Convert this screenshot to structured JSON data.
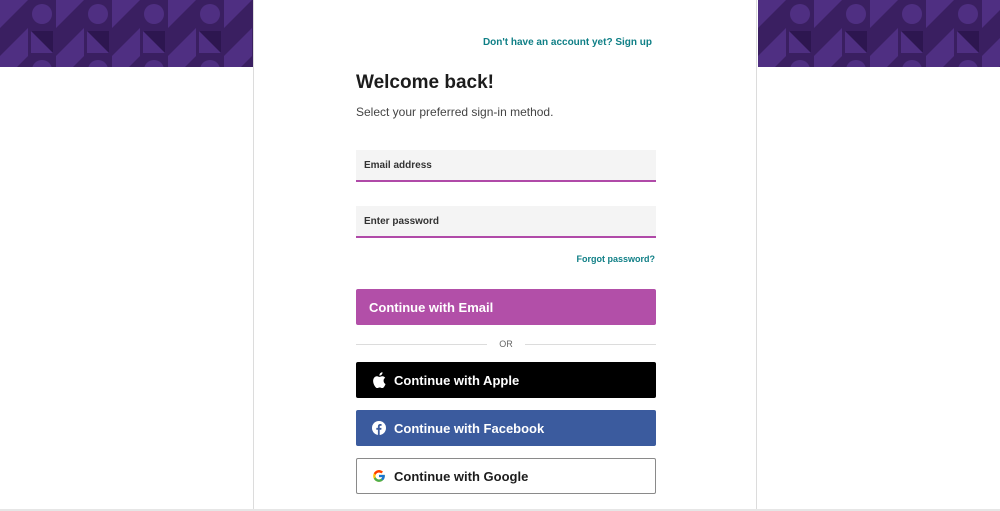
{
  "header": {
    "signup_link": "Don't have an account yet? Sign up"
  },
  "main": {
    "title": "Welcome back!",
    "subtitle": "Select your preferred sign-in method.",
    "email_placeholder": "Email address",
    "password_placeholder": "Enter password",
    "forgot_password": "Forgot password?",
    "continue_email": "Continue with Email",
    "or_divider": "OR",
    "continue_apple": "Continue with Apple",
    "continue_facebook": "Continue with Facebook",
    "continue_google": "Continue with Google"
  },
  "icons": {
    "apple": "apple-icon",
    "facebook": "facebook-icon",
    "google": "google-icon"
  },
  "colors": {
    "banner_background": "#3a1f61",
    "banner_pattern": "#4f2f82",
    "link_teal": "#0f7f86",
    "accent_purple": "#b24fa8",
    "apple_black": "#000000",
    "facebook_blue": "#3b5b9e"
  }
}
